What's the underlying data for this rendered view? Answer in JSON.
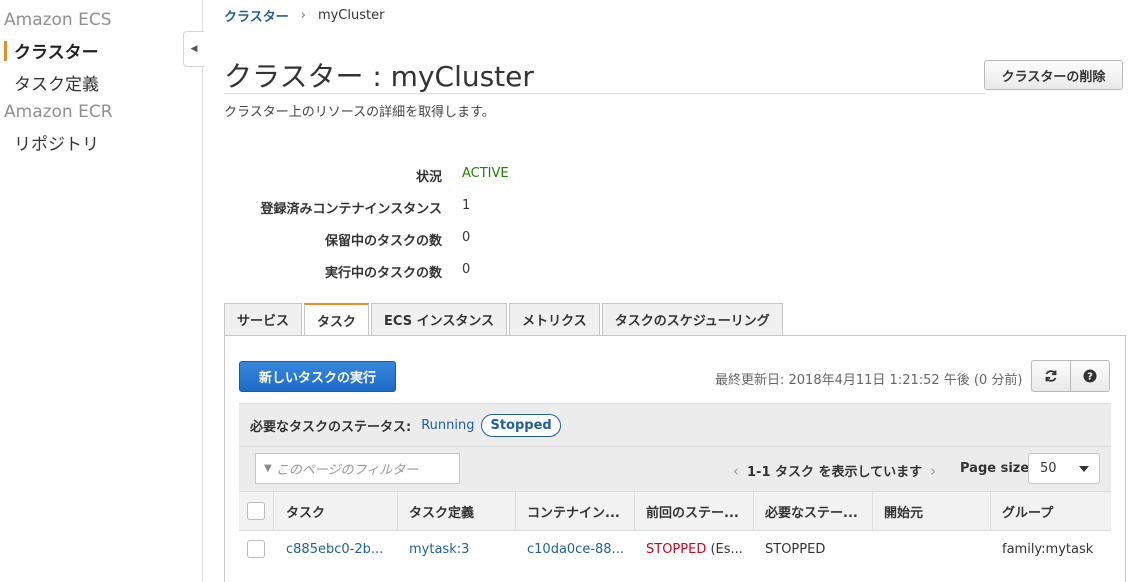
{
  "sidebar": {
    "groups": [
      {
        "title": "Amazon ECS",
        "items": [
          {
            "label": "クラスター",
            "active": true
          },
          {
            "label": "タスク定義",
            "active": false
          }
        ]
      },
      {
        "title": "Amazon ECR",
        "items": [
          {
            "label": "リポジトリ",
            "active": false
          }
        ]
      }
    ]
  },
  "breadcrumb": {
    "parent": "クラスター",
    "separator": "›",
    "current": "myCluster"
  },
  "page": {
    "title": "クラスター : myCluster",
    "subtitle": "クラスター上のリソースの詳細を取得します。",
    "delete_label": "クラスターの削除"
  },
  "status": [
    {
      "label": "状況",
      "value": "ACTIVE"
    },
    {
      "label": "登録済みコンテナインスタンス",
      "value": "1"
    },
    {
      "label": "保留中のタスクの数",
      "value": "0"
    },
    {
      "label": "実行中のタスクの数",
      "value": "0"
    }
  ],
  "tabs": [
    {
      "label": "サービス",
      "active": false
    },
    {
      "label": "タスク",
      "active": true
    },
    {
      "label": "ECS インスタンス",
      "active": false
    },
    {
      "label": "メトリクス",
      "active": false
    },
    {
      "label": "タスクのスケジューリング",
      "active": false
    }
  ],
  "toolbar": {
    "run_task_label": "新しいタスクの実行",
    "last_updated": "最終更新日: 2018年4月11日 1:21:52 午後 (0 分前)",
    "refresh_icon": "refresh-icon",
    "help_icon": "help-icon"
  },
  "desired_status": {
    "label": "必要なタスクのステータス:",
    "running": "Running",
    "stopped": "Stopped"
  },
  "filter": {
    "placeholder": "このページのフィルター",
    "icon": "funnel-icon"
  },
  "pagination": {
    "prev": "‹",
    "summary": "1-1 タスク を表示しています",
    "next": "›",
    "page_size_label": "Page size",
    "page_size": "50"
  },
  "colors": {
    "accent": "#e88d1f",
    "primary": "#1f73d6",
    "link": "#1f5f9c",
    "active_status": "#1d8102",
    "stopped": "#d0021b"
  },
  "table": {
    "headers": [
      "タスク",
      "タスク定義",
      "コンテナイン...",
      "前回のステー...",
      "必要なステー...",
      "開始元",
      "グループ"
    ],
    "rows": [
      {
        "task": "c885ebc0-2b...",
        "task_def": "mytask:3",
        "container_instance": "c10da0ce-88...",
        "last_status": "STOPPED",
        "last_status_suffix": " (Es...",
        "desired_status": "STOPPED",
        "started_by": "",
        "group": "family:mytask"
      }
    ]
  }
}
